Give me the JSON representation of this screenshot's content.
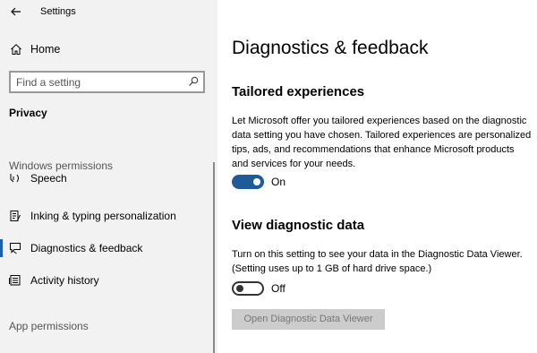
{
  "window": {
    "title": "Settings"
  },
  "sidebar": {
    "home_label": "Home",
    "search_placeholder": "Find a setting",
    "category": "Privacy",
    "windows_permissions_label": "Windows permissions",
    "items": [
      {
        "label": "Speech",
        "icon": "speech-icon"
      },
      {
        "label": "Inking & typing personalization",
        "icon": "inking-icon"
      },
      {
        "label": "Diagnostics & feedback",
        "icon": "feedback-icon",
        "selected": true
      },
      {
        "label": "Activity history",
        "icon": "activity-history-icon"
      }
    ],
    "app_permissions_label": "App permissions"
  },
  "main": {
    "title": "Diagnostics & feedback",
    "tailored": {
      "heading": "Tailored experiences",
      "description": "Let Microsoft offer you tailored experiences based on the diagnostic data setting you have chosen. Tailored experiences are personalized tips, ads, and recommendations that enhance Microsoft products and services for your needs.",
      "toggle_state": "On",
      "toggle_on": true
    },
    "view_data": {
      "heading": "View diagnostic data",
      "description": "Turn on this setting to see your data in the Diagnostic Data Viewer. (Setting uses up to 1 GB of hard drive space.)",
      "toggle_state": "Off",
      "toggle_on": false,
      "button_label": "Open Diagnostic Data Viewer"
    }
  },
  "colors": {
    "accent": "#1f5a99",
    "sidebar_bg": "#f2f2f2",
    "button_disabled_bg": "#cccccc"
  }
}
